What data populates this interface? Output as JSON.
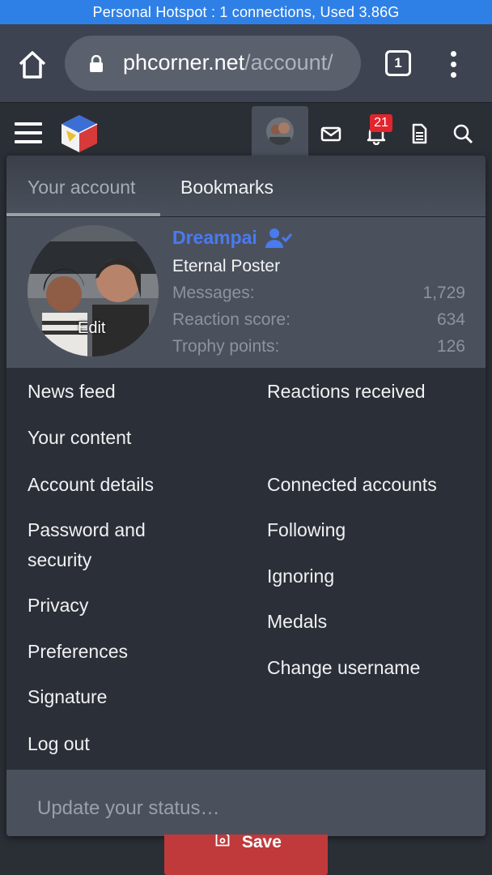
{
  "system": {
    "hotspot_text": "Personal Hotspot : 1 connections, Used 3.86G"
  },
  "browser": {
    "url_host": "phcorner.net",
    "url_path": "/account/",
    "tab_count": "1",
    "icons": [
      "home-icon",
      "lock-icon",
      "tabs-icon",
      "more-vert-icon"
    ]
  },
  "header": {
    "notification_count": "21",
    "icons": [
      "menu-icon",
      "site-logo",
      "envelope-icon",
      "bell-icon",
      "document-icon",
      "search-icon"
    ]
  },
  "account": {
    "tabs": [
      {
        "label": "Your account"
      },
      {
        "label": "Bookmarks"
      }
    ],
    "profile": {
      "username": "Dreampai",
      "title": "Eternal Poster",
      "edit_label": "Edit",
      "stats": [
        {
          "label": "Messages:",
          "value": "1,729"
        },
        {
          "label": "Reaction score:",
          "value": "634"
        },
        {
          "label": "Trophy points:",
          "value": "126"
        }
      ]
    },
    "menu_left": [
      "News feed",
      "Your content",
      "Account details",
      "Password and security",
      "Privacy",
      "Preferences",
      "Signature",
      "Log out"
    ],
    "menu_right": [
      "Reactions received",
      "Connected accounts",
      "Following",
      "Ignoring",
      "Medals",
      "Change username"
    ],
    "status_placeholder": "Update your status…"
  },
  "form": {
    "save_label": "Save"
  },
  "colors": {
    "hotspot": "#2f80e6",
    "username": "#4a7af0",
    "badge": "#e0252c",
    "save": "#c0393b"
  }
}
